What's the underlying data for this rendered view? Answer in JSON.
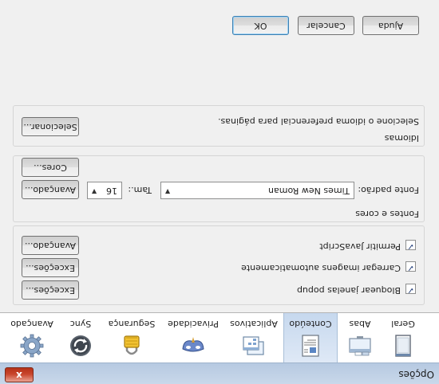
{
  "window": {
    "title": "Opções",
    "close_label": "x"
  },
  "tabs": [
    {
      "label": "Geral",
      "icon": "window-icon"
    },
    {
      "label": "Abas",
      "icon": "tabs-icon"
    },
    {
      "label": "Conteúdo",
      "icon": "document-icon",
      "active": true
    },
    {
      "label": "Aplicativos",
      "icon": "applications-icon"
    },
    {
      "label": "Privacidade",
      "icon": "mask-icon"
    },
    {
      "label": "Segurança",
      "icon": "padlock-icon"
    },
    {
      "label": "Sync",
      "icon": "sync-icon"
    },
    {
      "label": "Avançado",
      "icon": "gear-icon"
    }
  ],
  "content": {
    "popup": {
      "label": "Bloquear janelas popup",
      "checked": true,
      "button": "Exceções..."
    },
    "images": {
      "label": "Carregar imagens automaticamente",
      "checked": true,
      "button": "Exceções..."
    },
    "javascript": {
      "label": "Permitir JavaScript",
      "checked": true,
      "button": "Avançado..."
    }
  },
  "fonts": {
    "group_label": "Fontes e cores",
    "default_font_label": "Fonte padrão:",
    "default_font_value": "Times New Roman",
    "size_label": "Tam.:",
    "size_value": "16",
    "advanced_button": "Avançado...",
    "colors_button": "Cores..."
  },
  "languages": {
    "group_label": "Idiomas",
    "description": "Selecione o idioma preferencial para páginas.",
    "choose_button": "Selecionar..."
  },
  "footer": {
    "ok": "OK",
    "cancel": "Cancelar",
    "help": "Ajuda"
  }
}
